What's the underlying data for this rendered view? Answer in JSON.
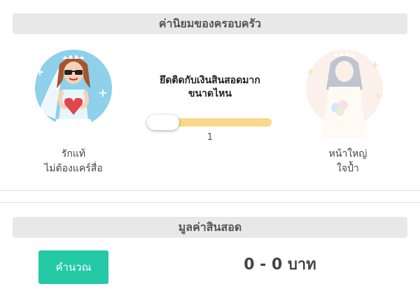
{
  "values_section": {
    "title": "ค่านิยมของครอบครัว",
    "question_line1": "ยึดติดกับเงินสินสอดมาก",
    "question_line2": "ขนาดไหน",
    "left_label_line1": "รักแท้",
    "left_label_line2": "ไม่ต้องแคร์สื่อ",
    "right_label_line1": "หน้าใหญ่",
    "right_label_line2": "ใจป้ำ",
    "slider": {
      "value_text": "1",
      "level": 0.0
    }
  },
  "dowry_section": {
    "title": "มูลค่าสินสอด",
    "button_label": "คำนวณ",
    "result_text": "0 - 0 บาท"
  },
  "colors": {
    "accent_button": "#24c9a6",
    "slider_fill": "#f8d98a",
    "avatar_left_bg": "#8fd0ea",
    "avatar_right_bg": "#f9d9c6"
  }
}
